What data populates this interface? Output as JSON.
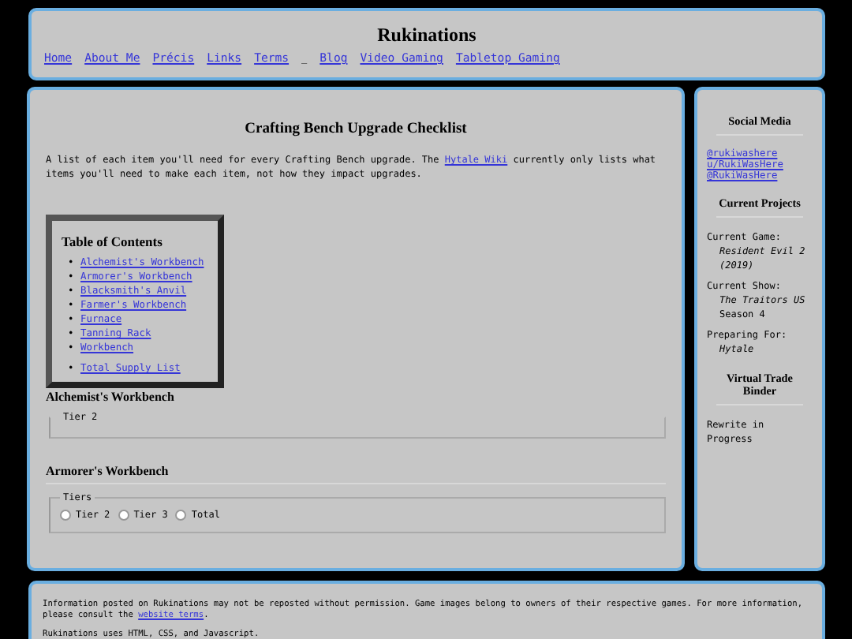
{
  "header": {
    "title": "Rukinations",
    "nav": [
      {
        "label": "Home"
      },
      {
        "label": "About Me"
      },
      {
        "label": "Précis"
      },
      {
        "label": "Links"
      },
      {
        "label": "Terms"
      },
      {
        "label": "_",
        "kind": "separator"
      },
      {
        "label": "Blog"
      },
      {
        "label": "Video Gaming"
      },
      {
        "label": "Tabletop Gaming"
      }
    ]
  },
  "main": {
    "title": "Crafting Bench Upgrade Checklist",
    "intro": {
      "before": "A list of each item you'll need for every Crafting Bench upgrade. The ",
      "link": "Hytale Wiki",
      "after": " currently only lists what items you'll need to make each item, not how they impact upgrades."
    },
    "toc": {
      "title": "Table of Contents",
      "items": [
        {
          "bullet": "•",
          "label": "Alchemist's Workbench"
        },
        {
          "bullet": "•",
          "label": "Armorer's Workbench"
        },
        {
          "bullet": "•",
          "label": "Blacksmith's Anvil"
        },
        {
          "bullet": "•",
          "label": "Farmer's Workbench"
        },
        {
          "bullet": "•",
          "label": "Furnace"
        },
        {
          "bullet": "•",
          "label": "Tanning Rack"
        },
        {
          "bullet": "•",
          "label": "Workbench"
        }
      ],
      "extra": [
        {
          "bullet": "•",
          "label": "Total Supply List"
        }
      ]
    },
    "sections": [
      {
        "title": "Alchemist's Workbench",
        "legend": "Tier 2"
      },
      {
        "title": "Armorer's Workbench",
        "legend": "Tiers",
        "options": [
          {
            "label": "Tier 2",
            "selected": false
          },
          {
            "label": "Tier 3",
            "selected": false
          },
          {
            "label": "Total",
            "selected": false
          }
        ]
      }
    ]
  },
  "sidebar": {
    "social": {
      "title": "Social Media",
      "links": [
        "@rukiwashere",
        "u/RukiWasHere",
        "@RukiWasHere"
      ]
    },
    "projects": {
      "title": "Current Projects",
      "entries": [
        {
          "label": "Current Game:",
          "value": "Resident Evil 2 (2019)"
        },
        {
          "label": "Current Show:",
          "value": "The Traitors US",
          "extra": "Season 4"
        },
        {
          "label": "Preparing For:",
          "value": "Hytale"
        }
      ]
    },
    "binder": {
      "title": "Virtual Trade Binder",
      "text": "Rewrite in Progress"
    }
  },
  "footer": {
    "notice": {
      "text": "Information posted on Rukinations may not be reposted without permission. Game images belong to owners of their respective games. For more information, please consult the ",
      "link": "website terms",
      "end": "."
    },
    "tech": "Rukinations uses HTML, CSS, and Javascript."
  }
}
